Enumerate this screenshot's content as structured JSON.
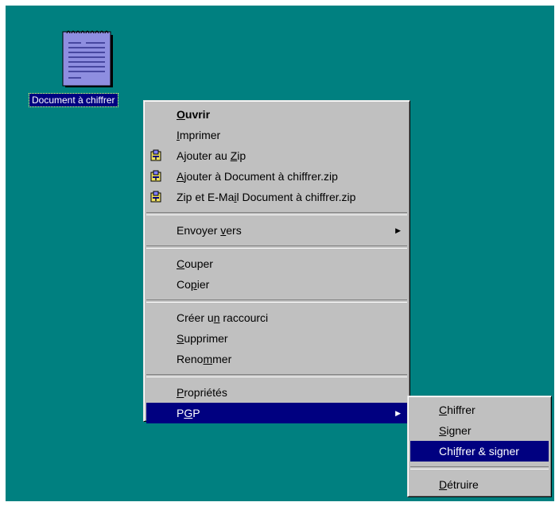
{
  "desktop": {
    "background": "#008080",
    "icon": {
      "name": "notepad-document-icon",
      "label": "Document à chiffrer"
    }
  },
  "context_menu": {
    "groups": [
      [
        {
          "pre": "",
          "u": "O",
          "post": "uvrir",
          "bold": true
        },
        {
          "pre": "",
          "u": "I",
          "post": "mprimer"
        },
        {
          "pre": "Ajouter au ",
          "u": "Z",
          "post": "ip",
          "icon": "winzip-icon"
        },
        {
          "pre": "",
          "u": "A",
          "post": "jouter à Document à chiffrer.zip",
          "icon": "winzip-icon"
        },
        {
          "pre": "Zip et E-Ma",
          "u": "i",
          "post": "l Document à chiffrer.zip",
          "icon": "winzip-icon"
        }
      ],
      [
        {
          "pre": "Envoyer ",
          "u": "v",
          "post": "ers",
          "submenu": true
        }
      ],
      [
        {
          "pre": "",
          "u": "C",
          "post": "ouper"
        },
        {
          "pre": "Co",
          "u": "p",
          "post": "ier"
        }
      ],
      [
        {
          "pre": "Créer u",
          "u": "n",
          "post": " raccourci"
        },
        {
          "pre": "",
          "u": "S",
          "post": "upprimer"
        },
        {
          "pre": "Reno",
          "u": "m",
          "post": "mer"
        }
      ],
      [
        {
          "pre": "",
          "u": "P",
          "post": "ropriétés"
        },
        {
          "pre": "P",
          "u": "G",
          "post": "P",
          "submenu": true,
          "selected": true
        }
      ]
    ]
  },
  "pgp_submenu": {
    "groups": [
      [
        {
          "pre": "",
          "u": "C",
          "post": "hiffrer"
        },
        {
          "pre": "",
          "u": "S",
          "post": "igner"
        },
        {
          "pre": "Chi",
          "u": "f",
          "post": "frer & signer",
          "selected": true
        }
      ],
      [
        {
          "pre": "",
          "u": "D",
          "post": "étruire"
        }
      ]
    ]
  },
  "colors": {
    "menu_bg": "#c0c0c0",
    "highlight": "#000080",
    "highlight_text": "#ffffff"
  }
}
